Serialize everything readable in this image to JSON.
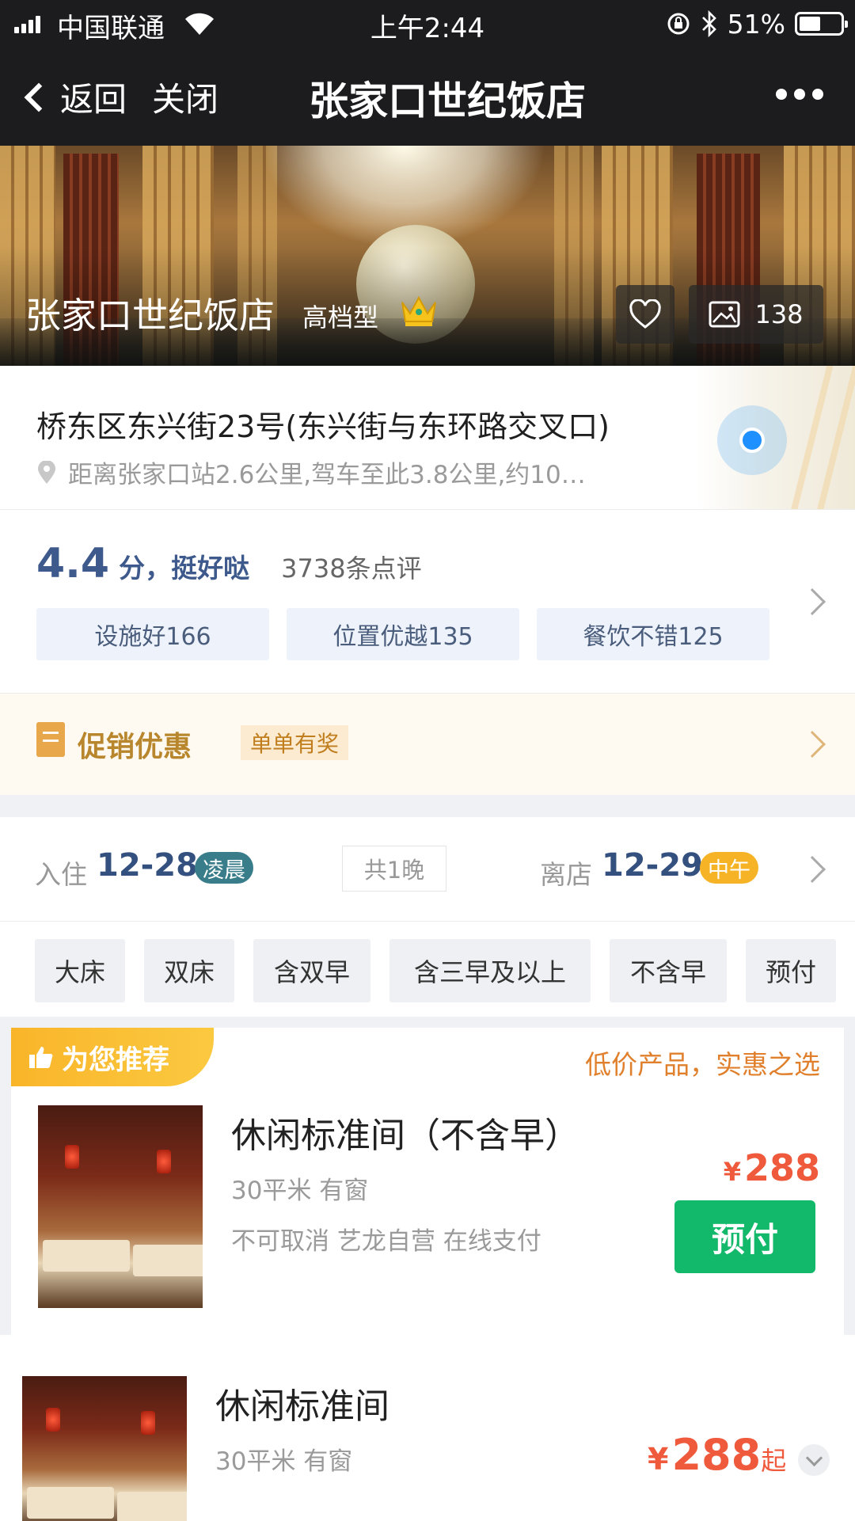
{
  "status_bar": {
    "carrier": "中国联通",
    "time": "上午2:44",
    "battery": "51%",
    "battery_level": 0.51,
    "icons": [
      "signal-icon",
      "wifi-icon",
      "orientation-lock-icon",
      "bluetooth-icon",
      "battery-icon"
    ]
  },
  "nav": {
    "back_label": "返回",
    "close_label": "关闭",
    "title": "张家口世纪饭店",
    "more_icon": "more-icon"
  },
  "hero": {
    "hotel_name": "张家口世纪饭店",
    "grade": "高档型",
    "photo_count": "138",
    "icons": [
      "crown-icon",
      "heart-icon",
      "image-icon"
    ]
  },
  "address": {
    "line": "桥东区东兴街23号(东兴街与东环路交叉口)",
    "distance": "距离张家口站2.6公里,驾车至此3.8公里,约10…",
    "icons": [
      "location-pin-icon",
      "map-location-dot-icon"
    ]
  },
  "rating": {
    "score": "4.4",
    "score_suffix": "分，挺好哒",
    "review_count": "3738条点评",
    "tags": [
      "设施好166",
      "位置优越135",
      "餐饮不错125"
    ]
  },
  "promo": {
    "title": "促销优惠",
    "badge": "单单有奖",
    "accent": "#b8862d"
  },
  "dates": {
    "checkin_label": "入住",
    "checkin_date": "12-28",
    "checkin_tag": "凌晨",
    "nights": "共1晚",
    "checkout_label": "离店",
    "checkout_date": "12-29",
    "checkout_tag": "中午"
  },
  "filters": [
    "大床",
    "双床",
    "含双早",
    "含三早及以上",
    "不含早",
    "预付"
  ],
  "recommended": {
    "ribbon": "为您推荐",
    "slogan": "低价产品，实惠之选",
    "room_name": "休闲标准间（不含早）",
    "room_meta": "30平米  有窗",
    "policy": "不可取消  艺龙自营  在线支付",
    "currency": "¥",
    "price": "288",
    "book_label": "预付",
    "book_color": "#13b96a"
  },
  "room2": {
    "room_name": "休闲标准间",
    "room_meta": "30平米  有窗",
    "currency": "¥",
    "price": "288",
    "price_suffix": "起"
  },
  "colors": {
    "price": "#f05a3c",
    "rating": "#3e5a8c",
    "checkin_tag": "#3a7d8a",
    "checkout_tag": "#f6b326"
  }
}
